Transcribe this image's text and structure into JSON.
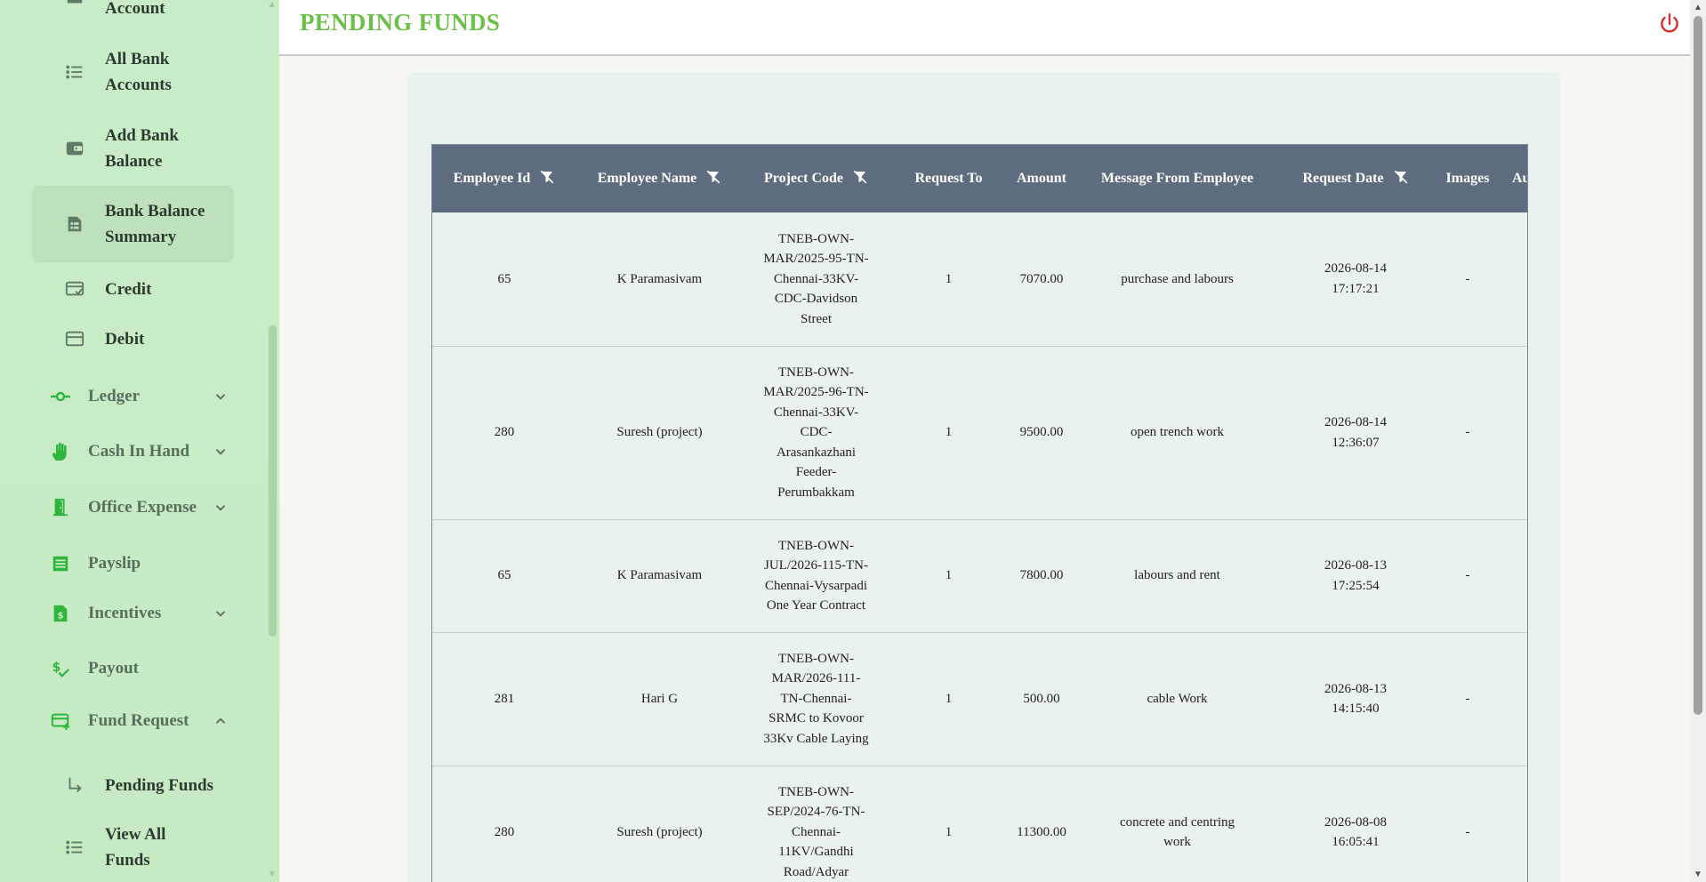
{
  "sidebar": {
    "sub_items_top": [
      {
        "label": "Account",
        "icon": "bank-account-icon"
      },
      {
        "label": "All Bank Accounts",
        "icon": "list-icon"
      },
      {
        "label": "Add Bank Balance",
        "icon": "wallet-icon"
      },
      {
        "label": "Bank Balance Summary",
        "icon": "summary-icon"
      },
      {
        "label": "Credit",
        "icon": "credit-check-icon"
      },
      {
        "label": "Debit",
        "icon": "card-icon"
      }
    ],
    "main_items": [
      {
        "label": "Ledger",
        "icon": "commit-icon"
      },
      {
        "label": "Cash In Hand",
        "icon": "hand-icon"
      },
      {
        "label": "Office Expense",
        "icon": "door-icon"
      },
      {
        "label": "Payslip",
        "icon": "receipt-icon"
      },
      {
        "label": "Incentives",
        "icon": "dollar-doc-icon"
      },
      {
        "label": "Payout",
        "icon": "dollar-check-icon"
      },
      {
        "label": "Fund Request",
        "icon": "card-add-icon"
      }
    ],
    "sub_items_bottom": [
      {
        "label": "Pending Funds",
        "icon": "subdirectory-arrow-icon"
      },
      {
        "label": "View All Funds",
        "icon": "list-icon"
      }
    ]
  },
  "header": {
    "title": "PENDING FUNDS"
  },
  "table": {
    "columns": [
      "Employee Id",
      "Employee Name",
      "Project Code",
      "Request To",
      "Amount",
      "Message From Employee",
      "Request Date",
      "Images",
      "Audio"
    ],
    "filterable": [
      true,
      true,
      true,
      false,
      false,
      false,
      true,
      false,
      false
    ],
    "rows": [
      {
        "employee_id": "65",
        "employee_name": "K Paramasivam",
        "project_code": "TNEB-OWN-MAR/2025-95-TN-Chennai-33KV-CDC-Davidson Street",
        "request_to": "1",
        "amount": "7070.00",
        "message": "purchase and labours",
        "request_date": "2026-08-14 17:17:21",
        "images": "-",
        "audio": "-"
      },
      {
        "employee_id": "280",
        "employee_name": "Suresh (project)",
        "project_code": "TNEB-OWN-MAR/2025-96-TN-Chennai-33KV-CDC-Arasankazhani Feeder-Perumbakkam",
        "request_to": "1",
        "amount": "9500.00",
        "message": "open trench work",
        "request_date": "2026-08-14 12:36:07",
        "images": "-",
        "audio": "-"
      },
      {
        "employee_id": "65",
        "employee_name": "K Paramasivam",
        "project_code": "TNEB-OWN-JUL/2026-115-TN-Chennai-Vysarpadi One Year Contract",
        "request_to": "1",
        "amount": "7800.00",
        "message": "labours and rent",
        "request_date": "2026-08-13 17:25:54",
        "images": "-",
        "audio": "-"
      },
      {
        "employee_id": "281",
        "employee_name": "Hari G",
        "project_code": "TNEB-OWN-MAR/2026-111-TN-Chennai-SRMC to Kovoor 33Kv Cable Laying",
        "request_to": "1",
        "amount": "500.00",
        "message": "cable Work",
        "request_date": "2026-08-13 14:15:40",
        "images": "-",
        "audio": "-"
      },
      {
        "employee_id": "280",
        "employee_name": "Suresh (project)",
        "project_code": "TNEB-OWN-SEP/2024-76-TN-Chennai-11KV/Gandhi Road/Adyar",
        "request_to": "1",
        "amount": "11300.00",
        "message": "concrete and centring work",
        "request_date": "2026-08-08 16:05:41",
        "images": "-",
        "audio": "-"
      }
    ]
  },
  "colors": {
    "sidebar_bg": "#c9ecc8",
    "accent_green": "#6cc04a",
    "table_header": "#5f6c7f",
    "power_red": "#d32f2f"
  }
}
